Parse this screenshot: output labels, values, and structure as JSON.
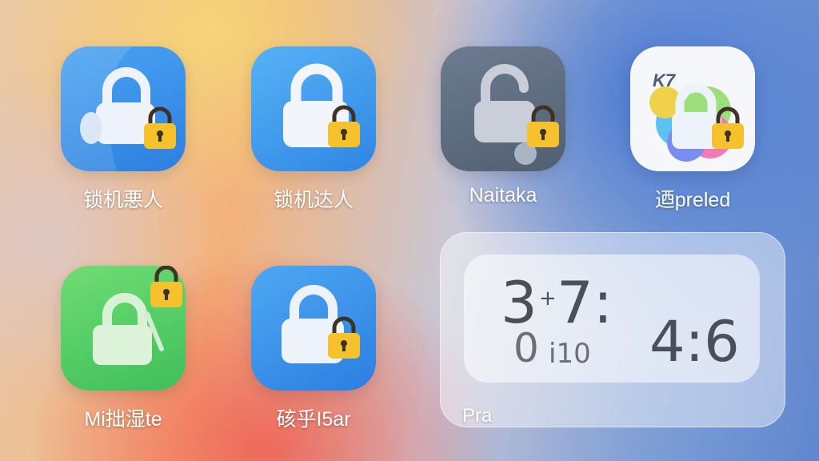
{
  "apps": [
    {
      "label": "锁机悪人"
    },
    {
      "label": "锁机达人"
    },
    {
      "label": "Naitaka"
    },
    {
      "label": "迺preled",
      "badge": "K7"
    },
    {
      "label": "Mi拙湿te"
    },
    {
      "label": "硋乎I5ar"
    }
  ],
  "widget": {
    "hour": "3",
    "plus": "+",
    "minute": "7:",
    "sub_left": "0",
    "sub_mid": "i10",
    "right_time": "4:6",
    "label": "Pra"
  },
  "colors": {
    "lock_badge": "#f5c22e",
    "blue_tile": "#2f86e4",
    "green_tile": "#45c25d",
    "slate_tile": "#5a677b"
  }
}
